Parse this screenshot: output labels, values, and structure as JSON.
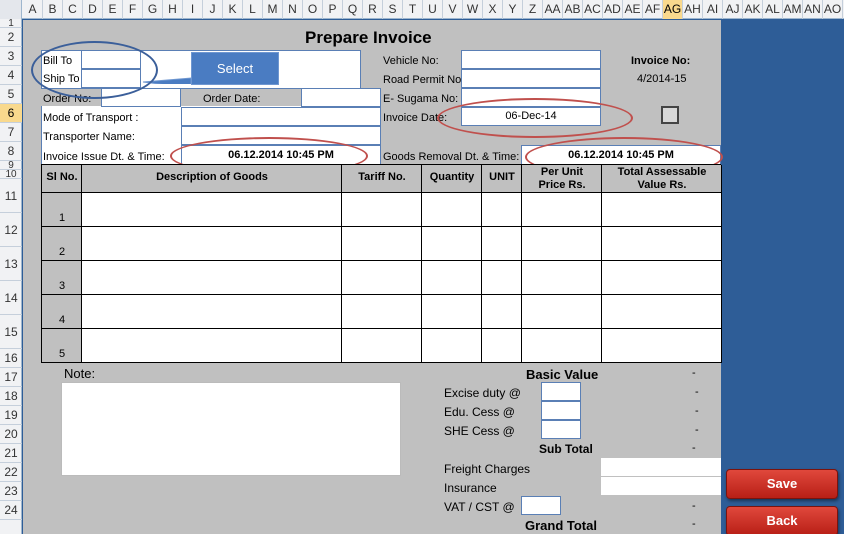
{
  "column_headers": [
    "A",
    "B",
    "C",
    "D",
    "E",
    "F",
    "G",
    "H",
    "I",
    "J",
    "K",
    "L",
    "M",
    "N",
    "O",
    "P",
    "Q",
    "R",
    "S",
    "T",
    "U",
    "V",
    "W",
    "X",
    "Y",
    "Z",
    "AA",
    "AB",
    "AC",
    "AD",
    "AE",
    "AF",
    "AG",
    "AH",
    "AI",
    "AJ",
    "AK",
    "AL",
    "AM",
    "AN",
    "AO"
  ],
  "active_column": "AG",
  "row_headers": [
    "1",
    "2",
    "3",
    "4",
    "5",
    "6",
    "7",
    "8",
    "9",
    "10",
    "11",
    "12",
    "13",
    "14",
    "15",
    "16",
    "17",
    "18",
    "19",
    "20",
    "21",
    "22",
    "23",
    "24"
  ],
  "active_row": "6",
  "form": {
    "title": "Prepare Invoice",
    "bill_to_label": "Bill To",
    "ship_to_label": "Ship To",
    "select_label": "Select",
    "order_no_label": "Order No:",
    "order_date_label": "Order Date:",
    "mode_of_transport_label": "Mode of Transport :",
    "transporter_name_label": "Transporter Name:",
    "invoice_issue_label": "Invoice Issue Dt. & Time:",
    "invoice_issue_value": "06.12.2014 10:45 PM",
    "vehicle_no_label": "Vehicle No:",
    "road_permit_label": "Road Permit No:",
    "e_sugama_label": "E- Sugama No:",
    "invoice_date_label": "Invoice Date:",
    "invoice_date_value": "06-Dec-14",
    "goods_removal_label": "Goods Removal Dt. & Time:",
    "goods_removal_value": "06.12.2014 10:45 PM",
    "invoice_no_label": "Invoice No:",
    "invoice_no_value": "4/2014-15"
  },
  "table": {
    "headers": {
      "sl_no": "Sl No.",
      "description": "Description of Goods",
      "tariff": "Tariff No.",
      "quantity": "Quantity",
      "unit": "UNIT",
      "per_unit_price_line1": "Per Unit",
      "per_unit_price_line2": "Price Rs.",
      "total_value_line1": "Total Assessable",
      "total_value_line2": "Value Rs."
    },
    "rows": [
      "1",
      "2",
      "3",
      "4",
      "5"
    ]
  },
  "summary": {
    "note_label": "Note:",
    "basic_value_label": "Basic Value",
    "basic_value": "-",
    "excise_label": "Excise duty @",
    "excise_value": "-",
    "edu_cess_label": "Edu. Cess @",
    "edu_cess_value": "-",
    "she_cess_label": "SHE Cess @",
    "she_cess_value": "-",
    "sub_total_label": "Sub Total",
    "sub_total_value": "-",
    "freight_label": "Freight Charges",
    "insurance_label": "Insurance",
    "vat_label": "VAT / CST @",
    "vat_value": "-",
    "grand_total_label": "Grand Total",
    "grand_total_value": "-"
  },
  "buttons": {
    "save": "Save",
    "back": "Back"
  },
  "colors": {
    "sheet_gray": "#c0c0c0",
    "side_blue": "#2e5d97",
    "button_red": "#c9281e",
    "callout_blue": "#4a7cc2",
    "highlight_oval": "#c0504d"
  }
}
